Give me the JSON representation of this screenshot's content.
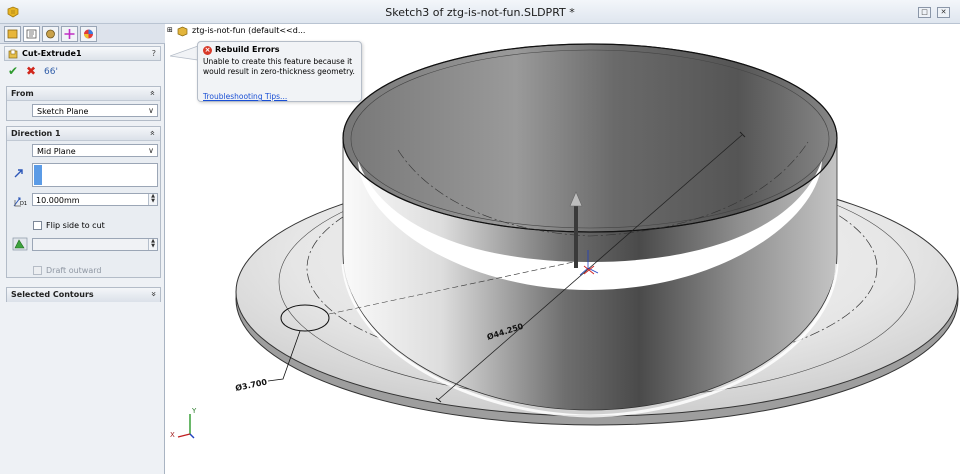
{
  "window": {
    "title": "Sketch3 of ztg-is-not-fun.SLDPRT *",
    "restore_glyph": "□",
    "close_glyph": "✕"
  },
  "panel": {
    "tabs": [
      "feature-manager-icon",
      "property-manager-icon",
      "configuration-manager-icon",
      "dimxpert-icon",
      "display-manager-icon"
    ],
    "feature_title": "Cut-Extrude1",
    "help_label": "?",
    "ok_glyph": "✔",
    "cancel_glyph": "✖",
    "detailed_preview_glyph": "66'",
    "from": {
      "header": "From",
      "collapse_glyph": "»",
      "value": "Sketch Plane",
      "arrow": "∨"
    },
    "direction1": {
      "header": "Direction 1",
      "collapse_glyph": "»",
      "end_condition": "Mid Plane",
      "arrow": "∨",
      "depth_value": "10.000mm",
      "depth_label": "D1",
      "flip_label": "Flip side to cut",
      "draft_label": "Draft outward"
    },
    "contours": {
      "header": "Selected Contours",
      "expand_glyph": "»"
    }
  },
  "tree": {
    "text": "ztg-is-not-fun  (default<<d..."
  },
  "tooltip": {
    "title": "Rebuild Errors",
    "error_glyph": "×",
    "body": "Unable to create this feature because it would result in zero-thickness geometry.",
    "link": "Troubleshooting Tips..."
  },
  "model": {
    "dim_large": "Ø44.250",
    "dim_small": "Ø3.700"
  },
  "triad": {
    "x": "X",
    "y": "Y"
  },
  "colors": {
    "link": "#1a4fd4",
    "error": "#d83a2a",
    "selection": "#5b9be6"
  }
}
